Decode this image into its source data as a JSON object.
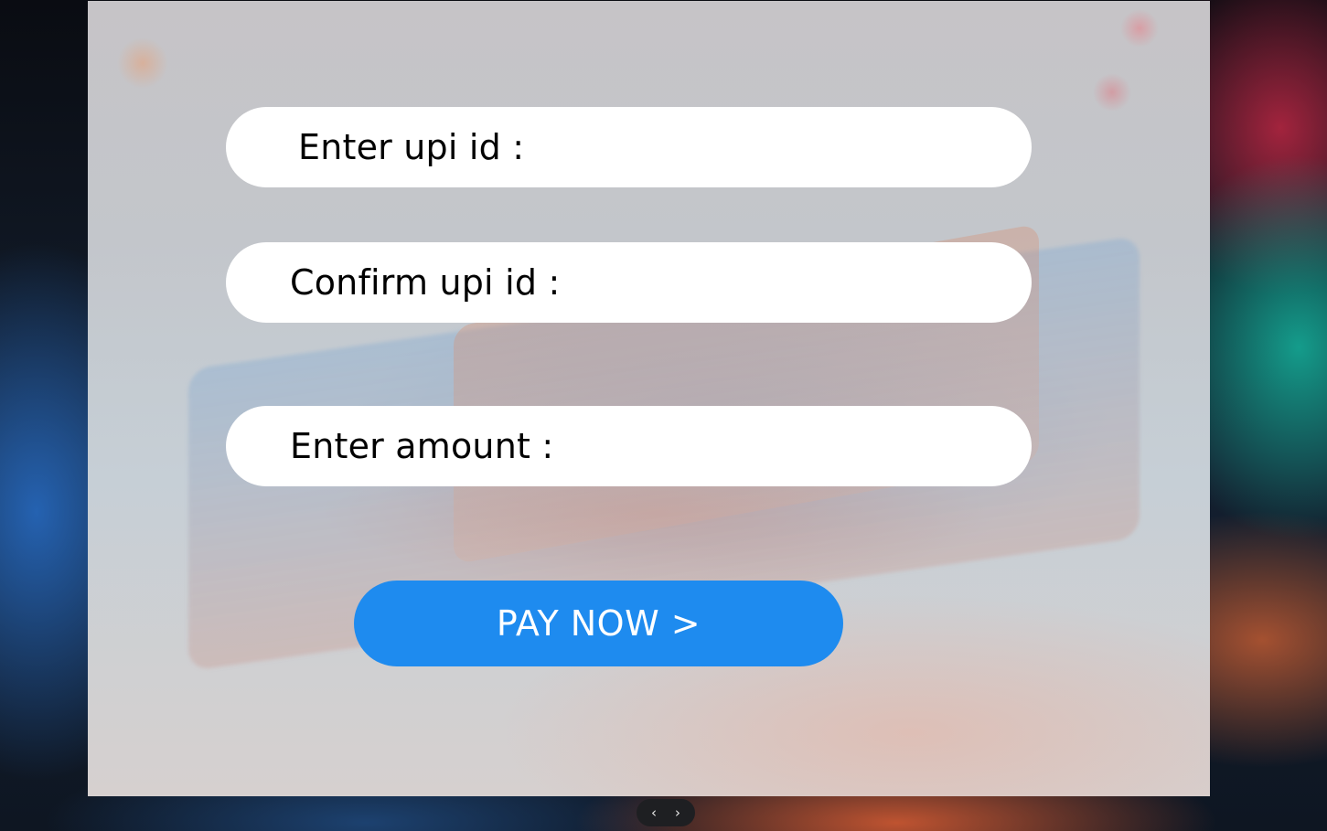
{
  "form": {
    "upi_label": "Enter upi id :",
    "confirm_label": "Confirm upi id :",
    "amount_label": "Enter amount :",
    "upi_value": "",
    "confirm_value": "",
    "amount_value": ""
  },
  "pay_button": {
    "label": "PAY NOW >",
    "color": "#1e8bef"
  },
  "pager": {
    "prev_glyph": "‹",
    "next_glyph": "›",
    "prev_icon": "chevron-left-icon",
    "next_icon": "chevron-right-icon"
  }
}
